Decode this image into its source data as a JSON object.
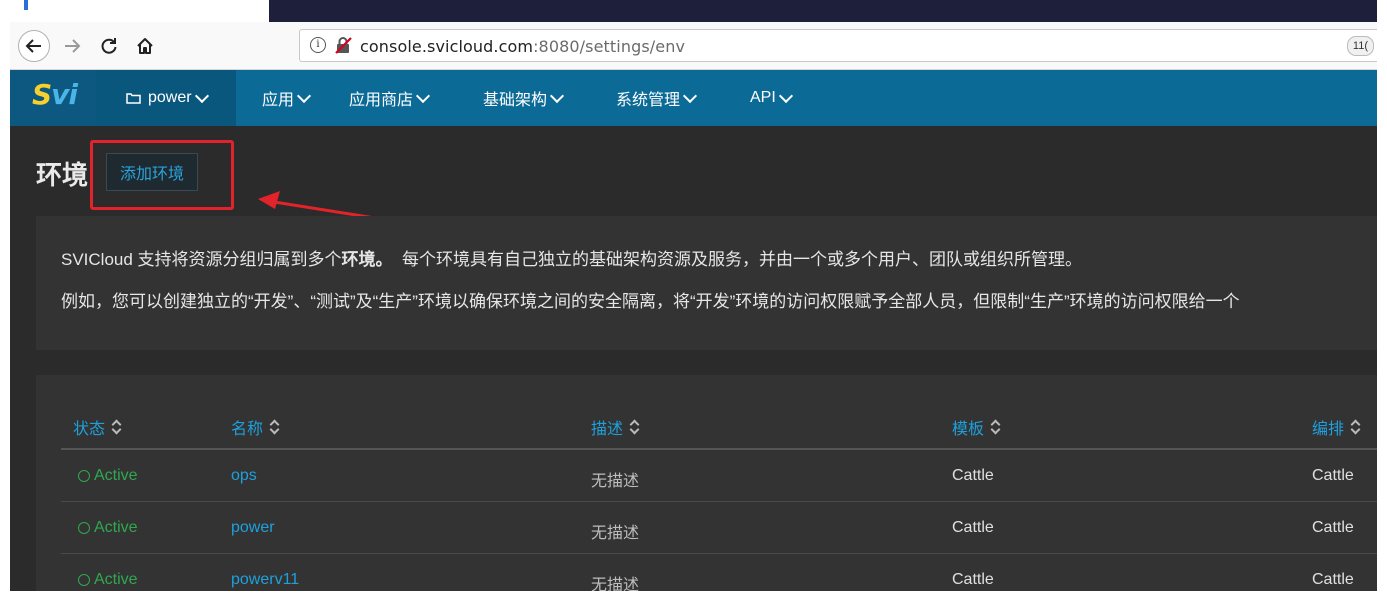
{
  "browser": {
    "url_host": "console.svicloud.com",
    "url_port_path": ":8080/settings/env",
    "badge": "11("
  },
  "app": {
    "logo": "Svi",
    "env_menu": "power",
    "nav": [
      "应用",
      "应用商店",
      "基础架构",
      "系统管理",
      "API"
    ]
  },
  "page": {
    "title": "环境",
    "add_button": "添加环境"
  },
  "info": {
    "line1_a": "SVICloud 支持将资源分组归属到多个",
    "line1_b": "环境。",
    "line1_c": "  每个环境具有自己独立的基础架构资源及服务，并由一个或多个用户、团队或组织所管理。",
    "line2": "例如，您可以创建独立的“开发”、“测试”及“生产”环境以确保环境之间的安全隔离，将“开发”环境的访问权限赋予全部人员，但限制“生产”环境的访问权限给一个"
  },
  "table": {
    "headers": [
      "状态",
      "名称",
      "描述",
      "模板",
      "编排"
    ],
    "rows": [
      {
        "status": "Active",
        "name": "ops",
        "desc": "无描述",
        "template": "Cattle",
        "orch": "Cattle"
      },
      {
        "status": "Active",
        "name": "power",
        "desc": "无描述",
        "template": "Cattle",
        "orch": "Cattle"
      },
      {
        "status": "Active",
        "name": "powerv11",
        "desc": "无描述",
        "template": "Cattle",
        "orch": "Cattle"
      }
    ]
  },
  "colors": {
    "nav_bg": "#0b6a96",
    "link": "#1ea0dc",
    "active": "#2fa84f",
    "annotation": "#e3232b"
  }
}
